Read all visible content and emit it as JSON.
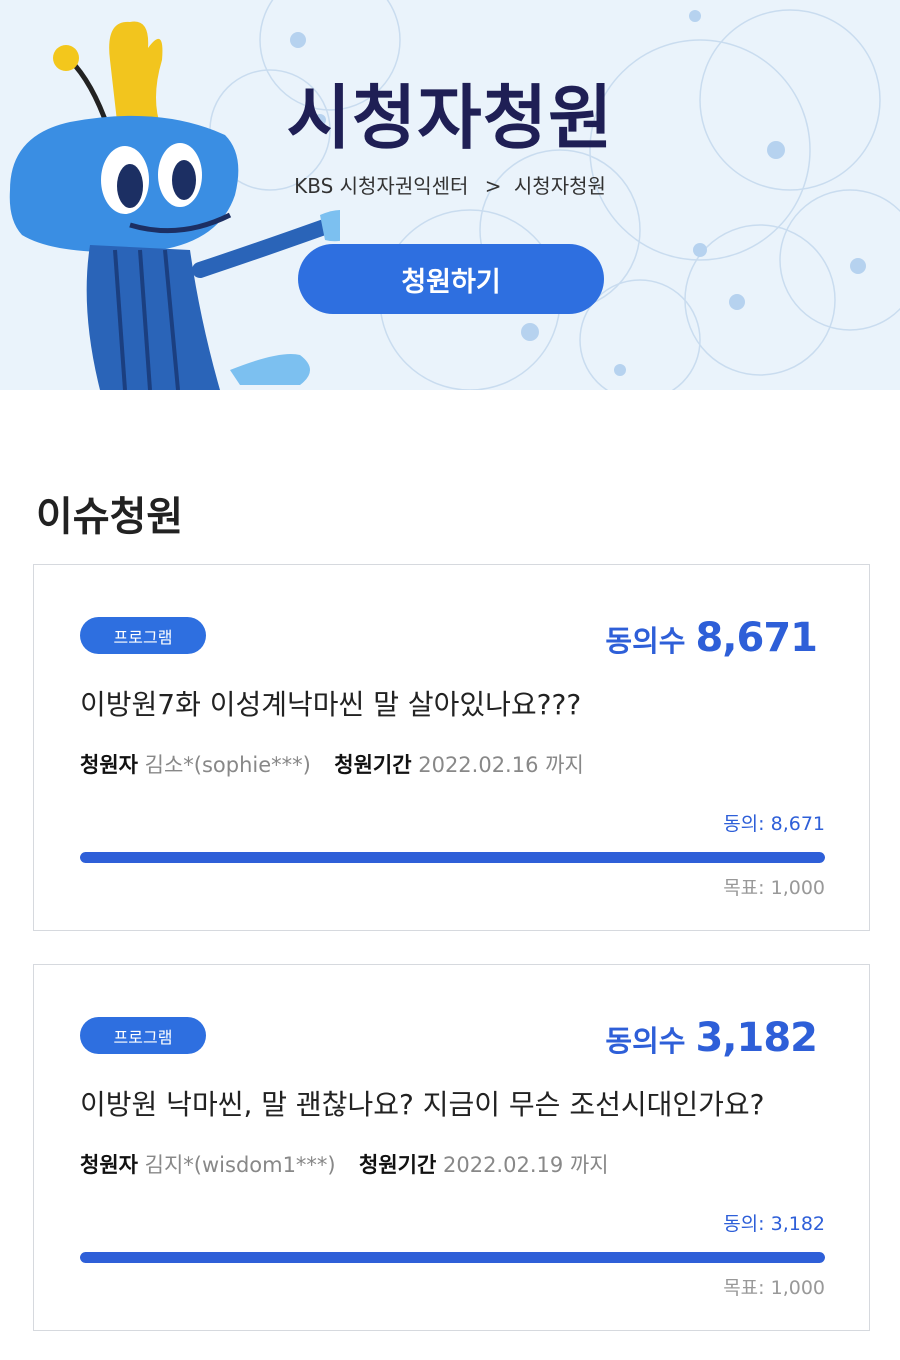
{
  "header": {
    "title": "시청자청원",
    "breadcrumb": [
      "KBS 시청자권익센터",
      "시청자청원"
    ],
    "breadcrumb_separator": ">",
    "cta_label": "청원하기"
  },
  "section": {
    "title": "이슈청원"
  },
  "petitions": [
    {
      "tag": "프로그램",
      "agree_label": "동의수",
      "agree_count": "8,671",
      "title": "이방원7화 이성계낙마씬 말 살아있나요???",
      "petitioner_label": "청원자",
      "petitioner": "김소*(sophie***)",
      "period_label": "청원기간",
      "period": "2022.02.16 까지",
      "agree_small": "동의: 8,671",
      "goal": "목표: 1,000",
      "progress": 1.0
    },
    {
      "tag": "프로그램",
      "agree_label": "동의수",
      "agree_count": "3,182",
      "title": "이방원 낙마씬, 말 괜찮나요? 지금이 무슨 조선시대인가요?",
      "petitioner_label": "청원자",
      "petitioner": "김지*(wisdom1***)",
      "period_label": "청원기간",
      "period": "2022.02.19 까지",
      "agree_small": "동의: 3,182",
      "goal": "목표: 1,000",
      "progress": 1.0
    }
  ],
  "colors": {
    "accent": "#2e6fe0",
    "count_blue": "#2e5fd8",
    "banner_bg": "#eaf3fb",
    "title_navy": "#1f1f55"
  },
  "icons": {
    "mascot": "kbs-mascot-icon"
  }
}
